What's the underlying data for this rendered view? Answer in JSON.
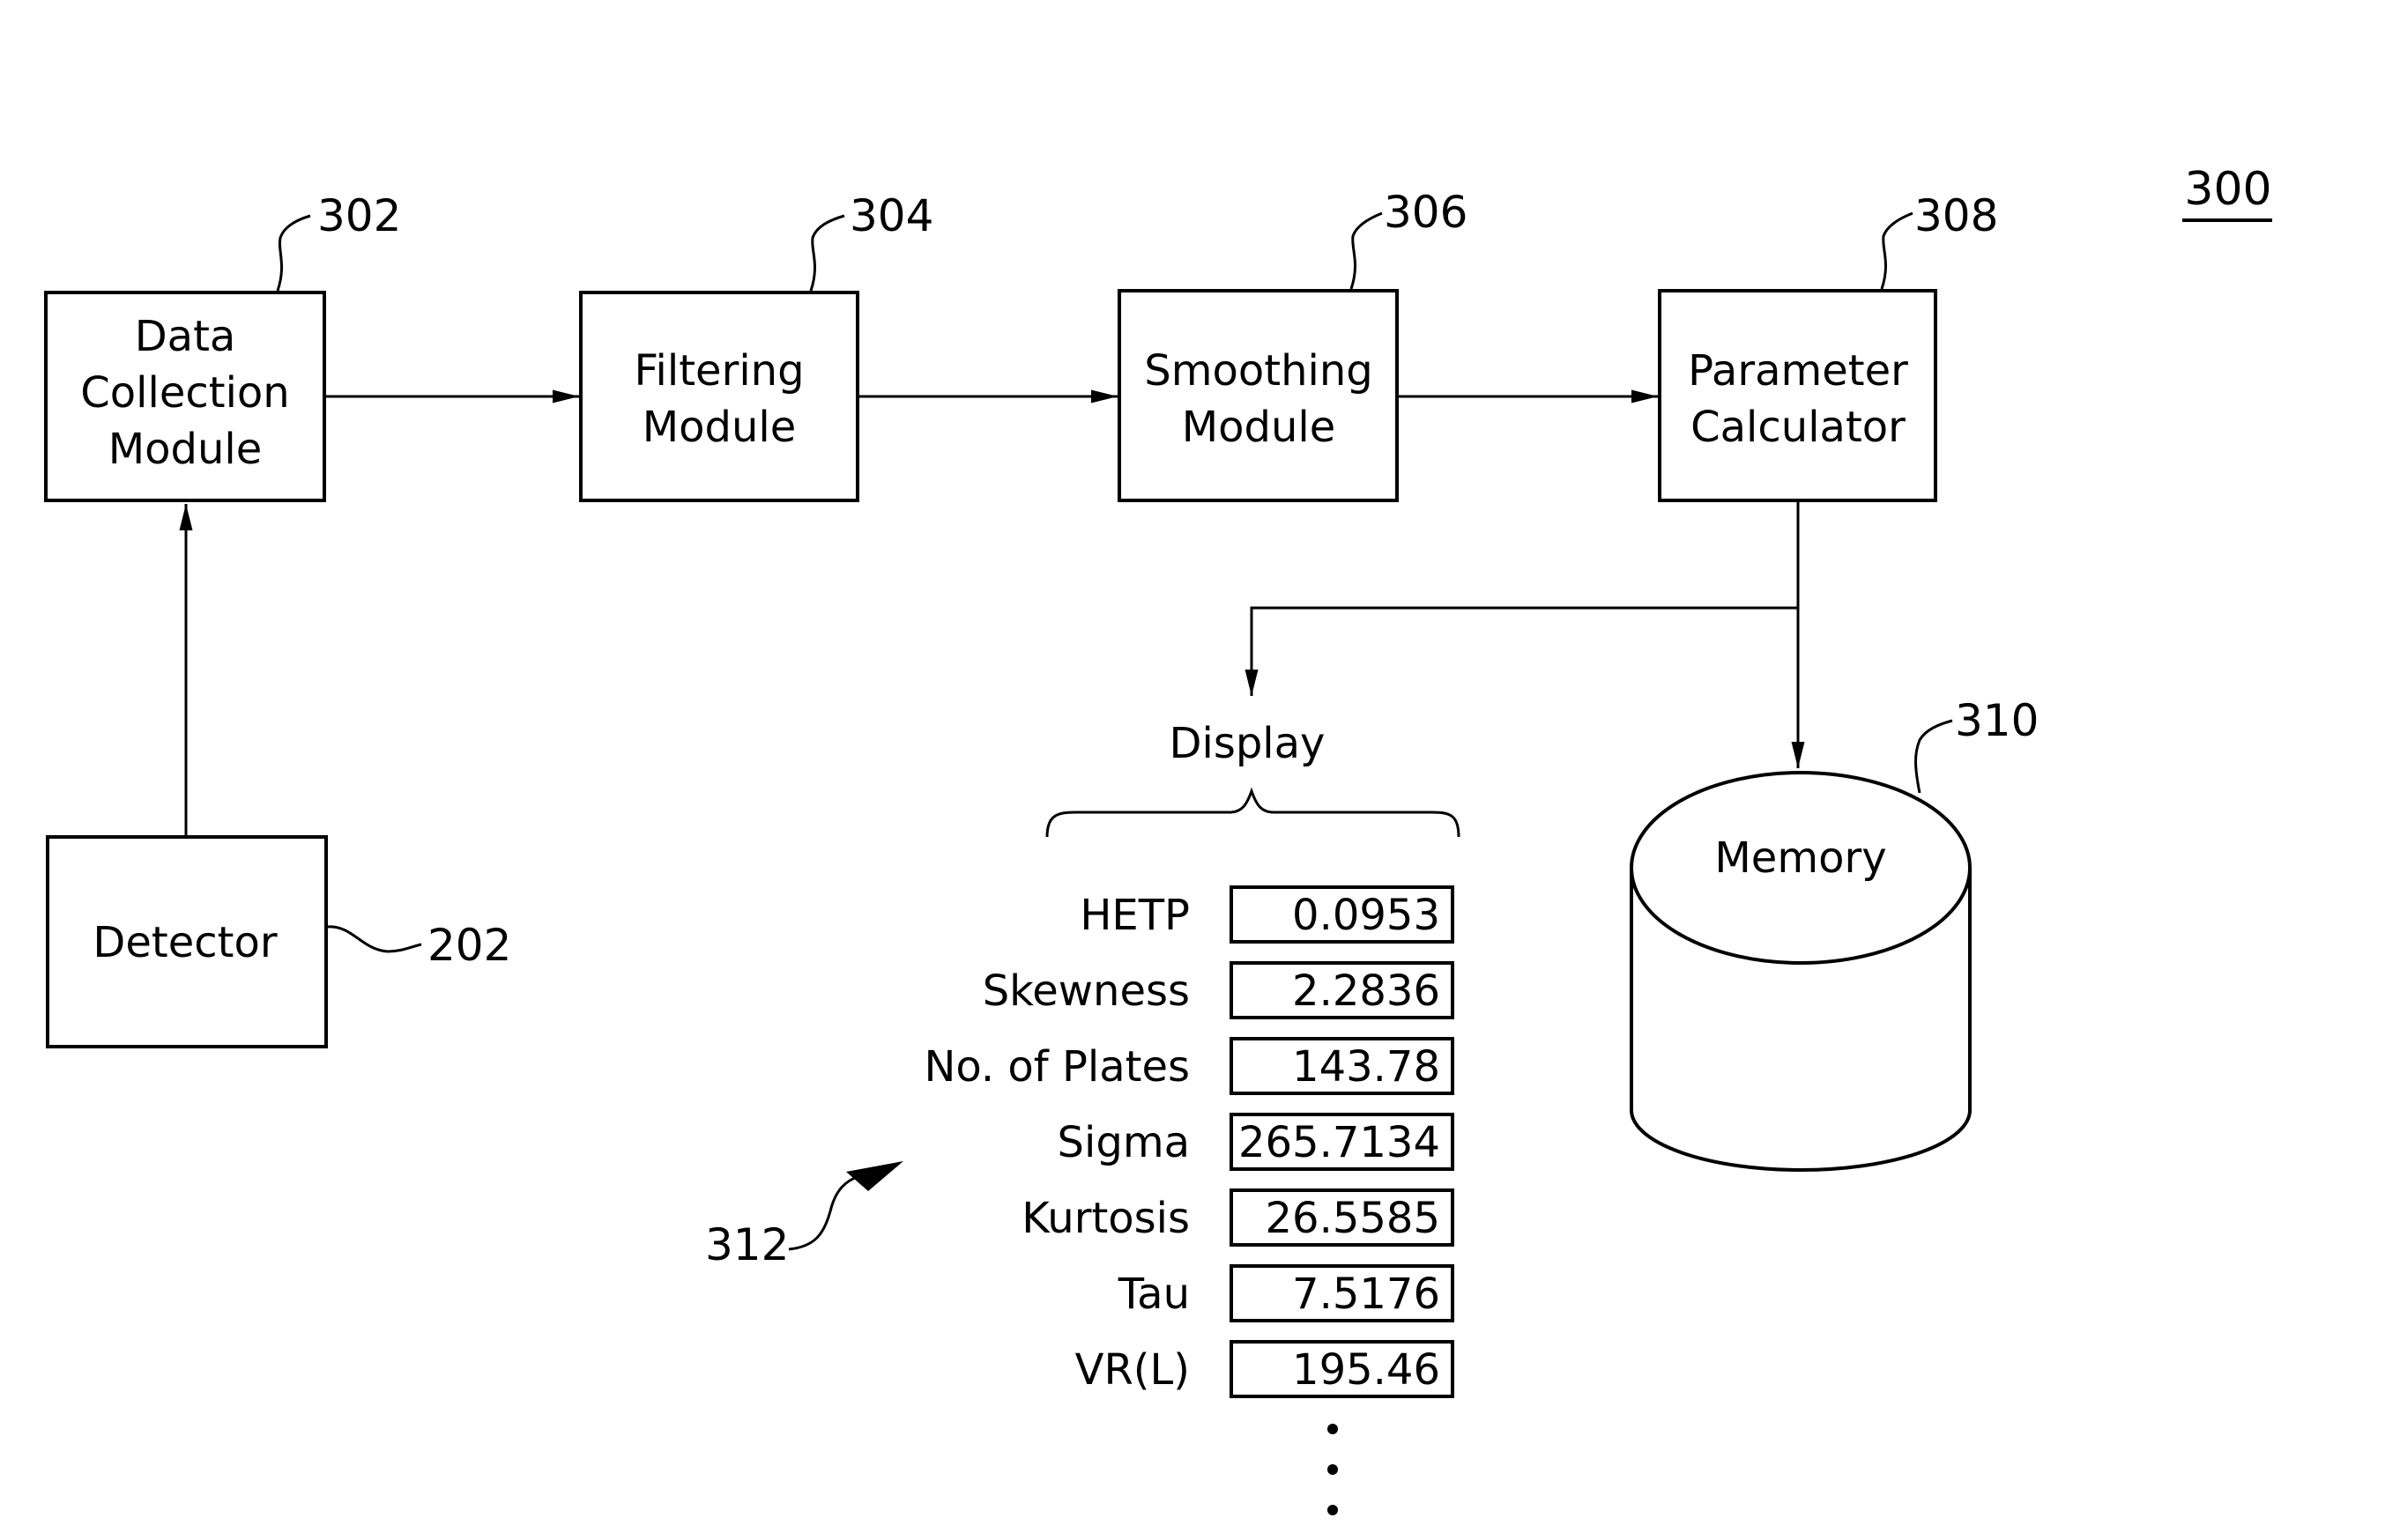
{
  "figure": {
    "number": "300"
  },
  "blocks": [
    {
      "id": "302",
      "ref": "302",
      "lines": [
        "Data",
        "Collection",
        "Module"
      ]
    },
    {
      "id": "304",
      "ref": "304",
      "lines": [
        "Filtering",
        "Module"
      ]
    },
    {
      "id": "306",
      "ref": "306",
      "lines": [
        "Smoothing",
        "Module"
      ]
    },
    {
      "id": "308",
      "ref": "308",
      "lines": [
        "Parameter",
        "Calculator"
      ]
    }
  ],
  "detector": {
    "label": "Detector",
    "ref": "202"
  },
  "memory": {
    "label": "Memory",
    "ref": "310"
  },
  "display": {
    "label": "Display",
    "ref": "312",
    "rows": [
      {
        "name": "HETP",
        "value": "0.0953"
      },
      {
        "name": "Skewness",
        "value": "2.2836"
      },
      {
        "name": "No.  of  Plates",
        "value": "143.78"
      },
      {
        "name": "Sigma",
        "value": "265.7134"
      },
      {
        "name": "Kurtosis",
        "value": "26.5585"
      },
      {
        "name": "Tau",
        "value": "7.5176"
      },
      {
        "name": "VR(L)",
        "value": "195.46"
      }
    ],
    "continuation": "⋮"
  }
}
